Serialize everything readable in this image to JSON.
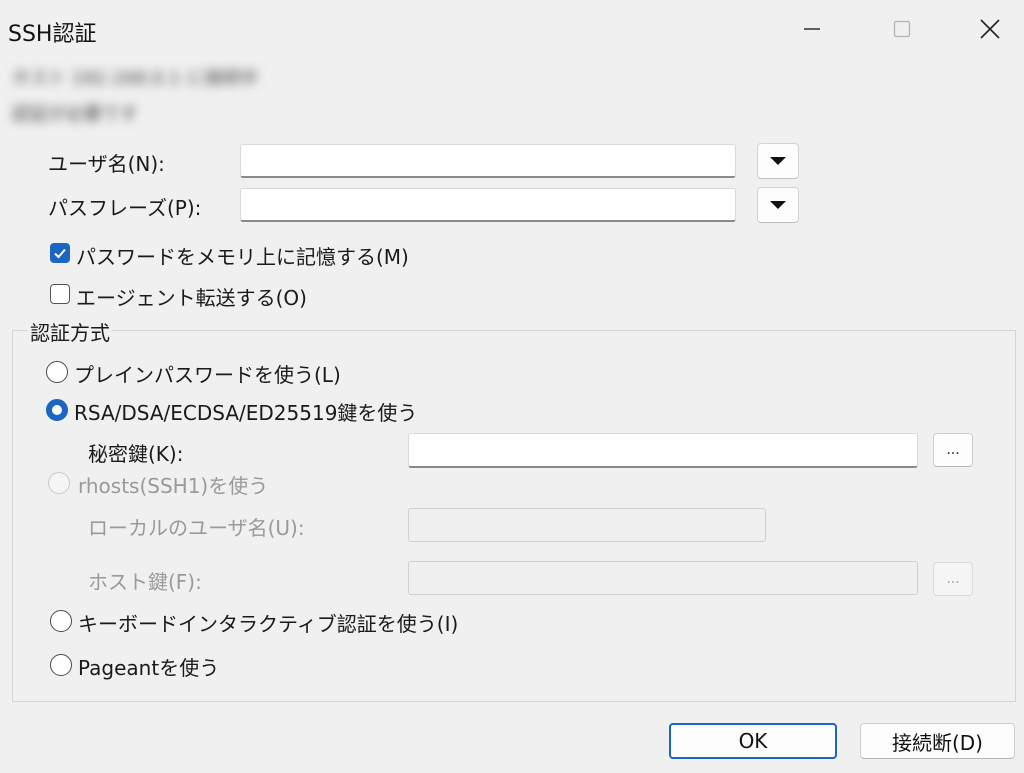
{
  "window": {
    "title": "SSH認証"
  },
  "info": {
    "line1": "ホスト 192.168.0.1 に接続中",
    "line2": "認証が必要です"
  },
  "form": {
    "username_label": "ユーザ名(N):",
    "username_value": "",
    "passphrase_label": "パスフレーズ(P):",
    "passphrase_value": "",
    "remember_password_label": "パスワードをメモリ上に記憶する(M)",
    "remember_password_checked": true,
    "agent_forward_label": "エージェント転送する(O)",
    "agent_forward_checked": false
  },
  "auth": {
    "group_title": "認証方式",
    "plain_password_label": "プレインパスワードを使う(L)",
    "public_key_label": "RSA/DSA/ECDSA/ED25519鍵を使う",
    "private_key_label": "秘密鍵(K):",
    "private_key_value": "",
    "browse_label": "...",
    "rhosts_label": "rhosts(SSH1)を使う",
    "local_user_label": "ローカルのユーザ名(U):",
    "host_key_label": "ホスト鍵(F):",
    "keyboard_interactive_label": "キーボードインタラクティブ認証を使う(I)",
    "pageant_label": "Pageantを使う",
    "selected": "public_key"
  },
  "buttons": {
    "ok": "OK",
    "disconnect": "接続断(D)"
  },
  "colors": {
    "accent": "#1a66c2",
    "background": "#f0f0f0"
  },
  "icons": {
    "minimize": "minimize-icon",
    "maximize": "maximize-icon",
    "close": "close-icon",
    "dropdown": "caret-down-icon",
    "check": "checkmark-icon"
  }
}
